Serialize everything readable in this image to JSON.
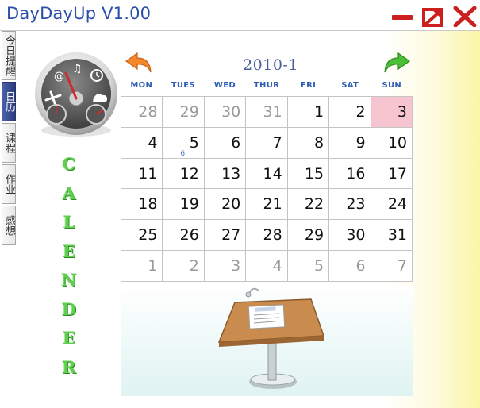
{
  "window": {
    "title": "DayDayUp  V1.00",
    "controls": {
      "minimize_icon": "minimize-icon",
      "restore_icon": "restore-icon",
      "close_icon": "close-icon",
      "accent": "#cc1f1f"
    }
  },
  "tabs": [
    {
      "label": "今日提醒",
      "active": false
    },
    {
      "label": "日历",
      "active": true
    },
    {
      "label": "课程",
      "active": false
    },
    {
      "label": "作业",
      "active": false
    },
    {
      "label": "感想",
      "active": false
    }
  ],
  "calendar": {
    "month_label": "2010-1",
    "prev_icon": "arrow-left-icon",
    "next_icon": "arrow-right-icon",
    "weekdays": [
      "MON",
      "TUES",
      "WED",
      "THUR",
      "FRI",
      "SAT",
      "SUN"
    ],
    "weeks": [
      [
        {
          "d": "28",
          "other": true
        },
        {
          "d": "29",
          "other": true
        },
        {
          "d": "30",
          "other": true
        },
        {
          "d": "31",
          "other": true
        },
        {
          "d": "1"
        },
        {
          "d": "2"
        },
        {
          "d": "3",
          "today": true
        }
      ],
      [
        {
          "d": "4"
        },
        {
          "d": "5",
          "mark": true
        },
        {
          "d": "6"
        },
        {
          "d": "7"
        },
        {
          "d": "8"
        },
        {
          "d": "9"
        },
        {
          "d": "10"
        }
      ],
      [
        {
          "d": "11"
        },
        {
          "d": "12"
        },
        {
          "d": "13"
        },
        {
          "d": "14"
        },
        {
          "d": "15"
        },
        {
          "d": "16"
        },
        {
          "d": "17"
        }
      ],
      [
        {
          "d": "18"
        },
        {
          "d": "19"
        },
        {
          "d": "20"
        },
        {
          "d": "21"
        },
        {
          "d": "22"
        },
        {
          "d": "23"
        },
        {
          "d": "24"
        }
      ],
      [
        {
          "d": "25"
        },
        {
          "d": "26"
        },
        {
          "d": "27"
        },
        {
          "d": "28"
        },
        {
          "d": "29"
        },
        {
          "d": "30"
        },
        {
          "d": "31"
        }
      ],
      [
        {
          "d": "1",
          "other": true
        },
        {
          "d": "2",
          "other": true
        },
        {
          "d": "3",
          "other": true
        },
        {
          "d": "4",
          "other": true
        },
        {
          "d": "5",
          "other": true
        },
        {
          "d": "6",
          "other": true
        },
        {
          "d": "7",
          "other": true
        }
      ]
    ],
    "event_mark": "6",
    "today_color": "#f6c5cf"
  },
  "side_word": [
    "C",
    "A",
    "L",
    "E",
    "N",
    "D",
    "E",
    "R"
  ],
  "dashboard_icon": "dashboard-icon",
  "podium_icon": "podium-icon"
}
